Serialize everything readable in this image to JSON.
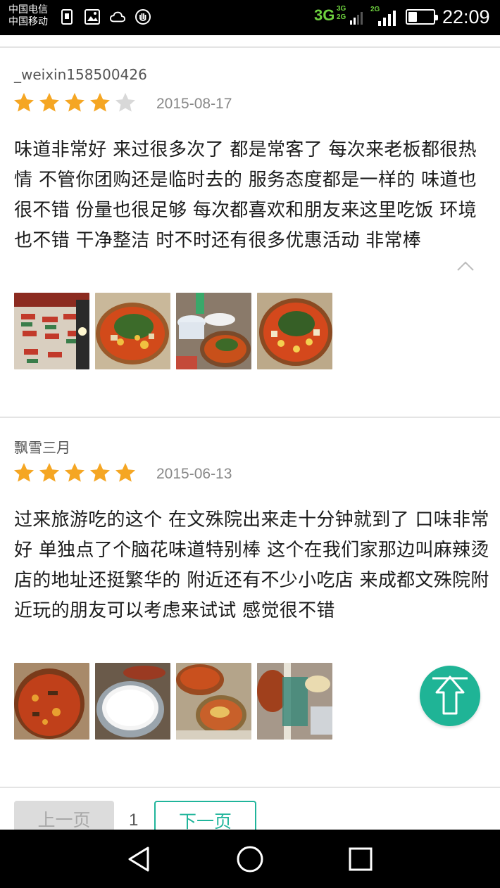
{
  "status_bar": {
    "carrier_1": "中国电信",
    "carrier_2": "中国移动",
    "net_3g": "3G",
    "net_stack_top": "3G",
    "net_stack_bottom": "2G",
    "net_2g": "2G",
    "battery_level": 0.35,
    "time": "22:09",
    "icons": [
      "sim-icon",
      "image-icon",
      "cloud-icon",
      "hand-icon"
    ]
  },
  "reviews": [
    {
      "username": "_weixin158500426",
      "rating": 4,
      "max_rating": 5,
      "date": "2015-08-17",
      "text": "味道非常好 来过很多次了 都是常客了 每次来老板都很热情 不管你团购还是临时去的 服务态度都是一样的 味道也很不错 份量也很足够 每次都喜欢和朋友来这里吃饭 环境也不错 干净整洁 时不时还有很多优惠活动 非常棒",
      "photo_count": 4
    },
    {
      "username": "飘雪三月",
      "rating": 5,
      "max_rating": 5,
      "date": "2015-06-13",
      "text": "过来旅游吃的这个 在文殊院出来走十分钟就到了 口味非常好 单独点了个脑花味道特别棒 这个在我们家那边叫麻辣烫 店的地址还挺繁华的 附近还有不少小吃店 来成都文殊院附近玩的朋友可以考虑来试试 感觉很不错",
      "photo_count": 4
    }
  ],
  "pagination": {
    "prev_label": "上一页",
    "current_page": "1",
    "next_label": "下一页"
  },
  "colors": {
    "accent": "#1fb496",
    "star_filled": "#f5a623",
    "star_empty": "#d8d8d8"
  },
  "nav_bar": {
    "icons": [
      "back-icon",
      "home-icon",
      "recents-icon"
    ]
  }
}
